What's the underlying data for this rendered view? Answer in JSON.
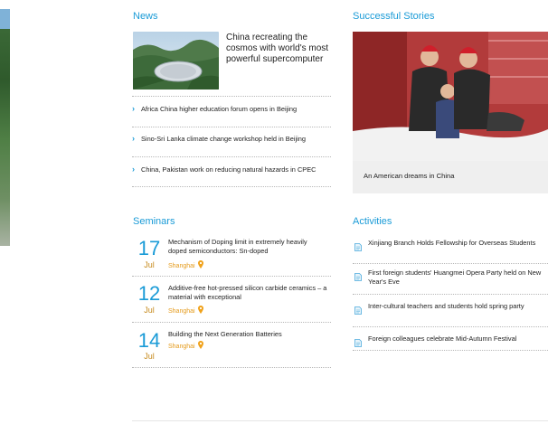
{
  "news": {
    "title": "News",
    "featured": "China recreating the cosmos with world's most powerful supercomputer",
    "items": [
      "Africa China higher education forum opens in Beijing",
      "Sino-Sri Lanka climate change workshop held in Beijing",
      "China, Pakistan work on reducing natural hazards in CPEC"
    ]
  },
  "stories": {
    "title": "Successful Stories",
    "caption": "An American dreams in China"
  },
  "seminars": {
    "title": "Seminars",
    "items": [
      {
        "day": "17",
        "month": "Jul",
        "title": "Mechanism of Doping limit in extremely heavily doped semiconductors: Sn-doped",
        "location": "Shanghai"
      },
      {
        "day": "12",
        "month": "Jul",
        "title": "Additive-free hot-pressed silicon carbide ceramics – a material with exceptional",
        "location": "Shanghai"
      },
      {
        "day": "14",
        "month": "Jul",
        "title": "Building the Next Generation Batteries",
        "location": "Shanghai"
      }
    ]
  },
  "activities": {
    "title": "Activities",
    "items": [
      "Xinjiang Branch Holds Fellowship for Overseas Students",
      "First foreign students' Huangmei Opera Party held on New Year's Eve",
      "Inter-cultural teachers and students hold spring party",
      "Foreign colleagues celebrate Mid-Autumn Festival"
    ]
  },
  "colors": {
    "accent": "#1a9bd7",
    "location": "#e49a1a",
    "month": "#c68a1d"
  }
}
